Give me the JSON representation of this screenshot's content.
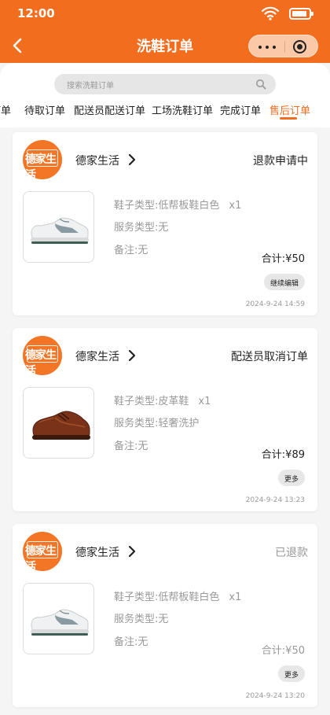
{
  "status_bar": {
    "time": "12:00"
  },
  "header": {
    "title": "洗鞋订单"
  },
  "search": {
    "placeholder": "搜索洗鞋订单"
  },
  "tabs": [
    {
      "label": "订单",
      "active": false
    },
    {
      "label": "待取订单",
      "active": false
    },
    {
      "label": "配送员配送订单",
      "active": false
    },
    {
      "label": "工场洗鞋订单",
      "active": false
    },
    {
      "label": "完成订单",
      "active": false
    },
    {
      "label": "售后订单",
      "active": true
    }
  ],
  "colors": {
    "brand": "#f26d1d",
    "logo": "#f27626",
    "capsule": "#fbc9a8"
  },
  "orders": [
    {
      "shop_name": "德家生活",
      "logo_text": "德家生活",
      "status": "退款申请中",
      "shoe_type_label": "鞋子类型:",
      "shoe_type": "低帮板鞋白色",
      "quantity": "x1",
      "service_label": "服务类型:",
      "service": "无",
      "remark_label": "备注:",
      "remark": "无",
      "total_label": "合计:",
      "total": "¥50",
      "action": "继续编辑",
      "date": "2024-9-24",
      "time": "14:59",
      "shoe_icon": "white-sneaker"
    },
    {
      "shop_name": "德家生活",
      "logo_text": "德家生活",
      "status": "配送员取消订单",
      "shoe_type_label": "鞋子类型:",
      "shoe_type": "皮革鞋",
      "quantity": "x1",
      "service_label": "服务类型:",
      "service": "轻奢洗护",
      "remark_label": "备注:",
      "remark": "无",
      "total_label": "合计:",
      "total": "¥89",
      "action": "更多",
      "date": "2024-9-24",
      "time": "13:23",
      "shoe_icon": "brown-leather-shoe"
    },
    {
      "shop_name": "德家生活",
      "logo_text": "德家生活",
      "status": "已退款",
      "shoe_type_label": "鞋子类型:",
      "shoe_type": "低帮板鞋白色",
      "quantity": "x1",
      "service_label": "服务类型:",
      "service": "无",
      "remark_label": "备注:",
      "remark": "无",
      "total_label": "合计:",
      "total": "¥50",
      "action": "更多",
      "date": "2024-9-24",
      "time": "13:20",
      "shoe_icon": "white-sneaker"
    }
  ]
}
